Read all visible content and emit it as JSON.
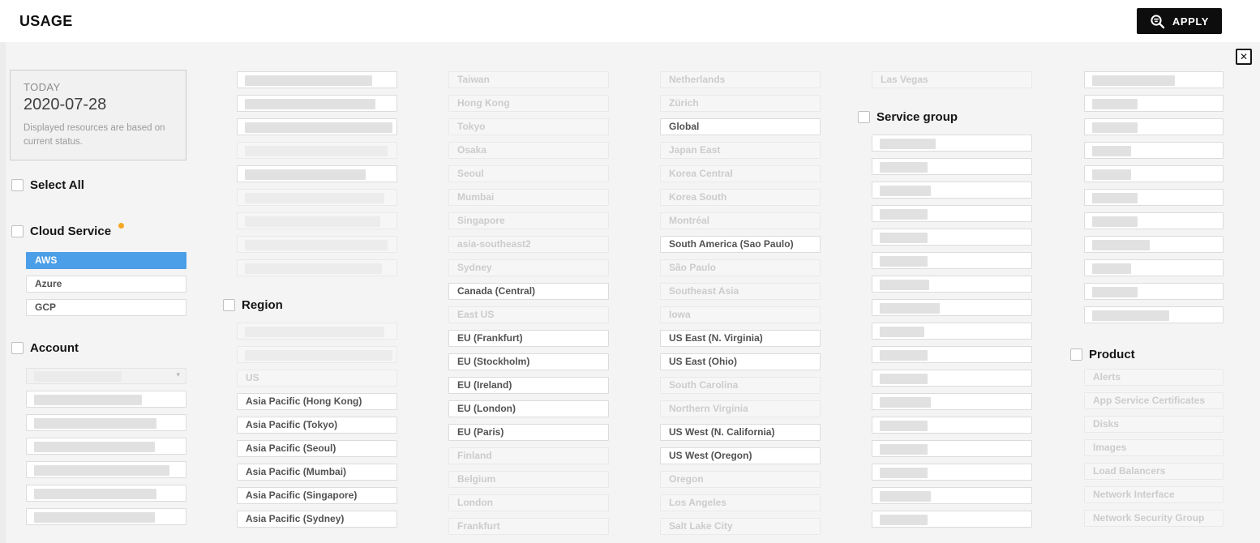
{
  "header": {
    "title": "USAGE",
    "apply_label": "APPLY",
    "apply_icon": "filter-search"
  },
  "colors": {
    "selected_blue": "#4B9EE8",
    "badge_orange": "#F5A623",
    "apply_black": "#0D0D0D"
  },
  "panel": {
    "close_glyph": "✕",
    "today": {
      "label": "TODAY",
      "date": "2020-07-28",
      "note": "Displayed resources are based on current status."
    },
    "select_all_label": "Select All",
    "cloud_service": {
      "label": "Cloud Service",
      "badge_color": "#F5A623",
      "items": [
        {
          "label": "AWS",
          "state": "selected"
        },
        {
          "label": "Azure",
          "state": "active"
        },
        {
          "label": "GCP",
          "state": "active"
        }
      ]
    },
    "account": {
      "label": "Account",
      "dropdown": {
        "redacted": true,
        "redact_w": 55
      },
      "items": [
        {
          "redacted": true,
          "state": "active",
          "redact_w": 68
        },
        {
          "redacted": true,
          "state": "active",
          "redact_w": 77
        },
        {
          "redacted": true,
          "state": "active",
          "redact_w": 76
        },
        {
          "redacted": true,
          "state": "active",
          "redact_w": 85
        },
        {
          "redacted": true,
          "state": "active",
          "redact_w": 77
        },
        {
          "redacted": true,
          "state": "active",
          "redact_w": 76
        }
      ]
    },
    "col2_top_items": [
      {
        "redacted": true,
        "state": "active",
        "redact_w": 80
      },
      {
        "redacted": true,
        "state": "active",
        "redact_w": 82
      },
      {
        "redacted": true,
        "state": "active",
        "redact_w": 93
      },
      {
        "redacted": true,
        "state": "disabled",
        "redact_w": 90
      },
      {
        "redacted": true,
        "state": "active",
        "redact_w": 76
      },
      {
        "redacted": true,
        "state": "disabled",
        "redact_w": 88
      },
      {
        "redacted": true,
        "state": "disabled",
        "redact_w": 85
      },
      {
        "redacted": true,
        "state": "disabled",
        "redact_w": 90
      },
      {
        "redacted": true,
        "state": "disabled",
        "redact_w": 86
      }
    ],
    "region": {
      "label": "Region",
      "col2_items": [
        {
          "redacted": true,
          "state": "disabled",
          "redact_w": 88
        },
        {
          "redacted": true,
          "state": "disabled",
          "redact_w": 93
        },
        {
          "label": "US",
          "state": "disabled"
        },
        {
          "label": "Asia Pacific (Hong Kong)",
          "state": "active"
        },
        {
          "label": "Asia Pacific (Tokyo)",
          "state": "active"
        },
        {
          "label": "Asia Pacific (Seoul)",
          "state": "active"
        },
        {
          "label": "Asia Pacific (Mumbai)",
          "state": "active"
        },
        {
          "label": "Asia Pacific (Singapore)",
          "state": "active"
        },
        {
          "label": "Asia Pacific (Sydney)",
          "state": "active"
        }
      ],
      "col3_items": [
        {
          "label": "Taiwan",
          "state": "disabled"
        },
        {
          "label": "Hong Kong",
          "state": "disabled"
        },
        {
          "label": "Tokyo",
          "state": "disabled"
        },
        {
          "label": "Osaka",
          "state": "disabled"
        },
        {
          "label": "Seoul",
          "state": "disabled"
        },
        {
          "label": "Mumbai",
          "state": "disabled"
        },
        {
          "label": "Singapore",
          "state": "disabled"
        },
        {
          "label": "asia-southeast2",
          "state": "disabled"
        },
        {
          "label": "Sydney",
          "state": "disabled"
        },
        {
          "label": "Canada (Central)",
          "state": "active"
        },
        {
          "label": "East US",
          "state": "disabled"
        },
        {
          "label": "EU (Frankfurt)",
          "state": "active"
        },
        {
          "label": "EU (Stockholm)",
          "state": "active"
        },
        {
          "label": "EU (Ireland)",
          "state": "active"
        },
        {
          "label": "EU (London)",
          "state": "active"
        },
        {
          "label": "EU (Paris)",
          "state": "active"
        },
        {
          "label": "Finland",
          "state": "disabled"
        },
        {
          "label": "Belgium",
          "state": "disabled"
        },
        {
          "label": "London",
          "state": "disabled"
        },
        {
          "label": "Frankfurt",
          "state": "disabled"
        }
      ],
      "col4_items": [
        {
          "label": "Netherlands",
          "state": "disabled"
        },
        {
          "label": "Zürich",
          "state": "disabled"
        },
        {
          "label": "Global",
          "state": "active"
        },
        {
          "label": "Japan East",
          "state": "disabled"
        },
        {
          "label": "Korea Central",
          "state": "disabled"
        },
        {
          "label": "Korea South",
          "state": "disabled"
        },
        {
          "label": "Montréal",
          "state": "disabled"
        },
        {
          "label": "South America (Sao Paulo)",
          "state": "active"
        },
        {
          "label": "São Paulo",
          "state": "disabled"
        },
        {
          "label": "Southeast Asia",
          "state": "disabled"
        },
        {
          "label": "Iowa",
          "state": "disabled"
        },
        {
          "label": "US East (N. Virginia)",
          "state": "active"
        },
        {
          "label": "US East (Ohio)",
          "state": "active"
        },
        {
          "label": "South Carolina",
          "state": "disabled"
        },
        {
          "label": "Northern Virginia",
          "state": "disabled"
        },
        {
          "label": "US West (N. California)",
          "state": "active"
        },
        {
          "label": "US West (Oregon)",
          "state": "active"
        },
        {
          "label": "Oregon",
          "state": "disabled"
        },
        {
          "label": "Los Angeles",
          "state": "disabled"
        },
        {
          "label": "Salt Lake City",
          "state": "disabled"
        }
      ],
      "col5_items": [
        {
          "label": "Las Vegas",
          "state": "disabled"
        }
      ]
    },
    "service_group": {
      "label": "Service group",
      "items": [
        {
          "redacted": true,
          "state": "active",
          "redact_w": 35
        },
        {
          "redacted": true,
          "state": "active",
          "redact_w": 30
        },
        {
          "redacted": true,
          "state": "active",
          "redact_w": 32
        },
        {
          "redacted": true,
          "state": "active",
          "redact_w": 30
        },
        {
          "redacted": true,
          "state": "active",
          "redact_w": 30
        },
        {
          "redacted": true,
          "state": "active",
          "redact_w": 30
        },
        {
          "redacted": true,
          "state": "active",
          "redact_w": 31
        },
        {
          "redacted": true,
          "state": "active",
          "redact_w": 38
        },
        {
          "redacted": true,
          "state": "active",
          "redact_w": 28
        },
        {
          "redacted": true,
          "state": "active",
          "redact_w": 30
        },
        {
          "redacted": true,
          "state": "active",
          "redact_w": 30
        },
        {
          "redacted": true,
          "state": "active",
          "redact_w": 32
        },
        {
          "redacted": true,
          "state": "active",
          "redact_w": 30
        },
        {
          "redacted": true,
          "state": "active",
          "redact_w": 30
        },
        {
          "redacted": true,
          "state": "active",
          "redact_w": 30
        },
        {
          "redacted": true,
          "state": "active",
          "redact_w": 32
        },
        {
          "redacted": true,
          "state": "active",
          "redact_w": 30
        }
      ]
    },
    "col6_top_items": [
      {
        "redacted": true,
        "state": "active",
        "redact_w": 60
      },
      {
        "redacted": true,
        "state": "active",
        "redact_w": 33
      },
      {
        "redacted": true,
        "state": "active",
        "redact_w": 33
      },
      {
        "redacted": true,
        "state": "active",
        "redact_w": 28
      },
      {
        "redacted": true,
        "state": "active",
        "redact_w": 28
      },
      {
        "redacted": true,
        "state": "active",
        "redact_w": 33
      },
      {
        "redacted": true,
        "state": "active",
        "redact_w": 33
      },
      {
        "redacted": true,
        "state": "active",
        "redact_w": 42
      },
      {
        "redacted": true,
        "state": "active",
        "redact_w": 28
      },
      {
        "redacted": true,
        "state": "active",
        "redact_w": 33
      },
      {
        "redacted": true,
        "state": "active",
        "redact_w": 56
      }
    ],
    "product": {
      "label": "Product",
      "items": [
        {
          "label": "Alerts",
          "state": "disabled"
        },
        {
          "label": "App Service Certificates",
          "state": "disabled"
        },
        {
          "label": "Disks",
          "state": "disabled"
        },
        {
          "label": "Images",
          "state": "disabled"
        },
        {
          "label": "Load Balancers",
          "state": "disabled"
        },
        {
          "label": "Network Interface",
          "state": "disabled"
        },
        {
          "label": "Network Security Group",
          "state": "disabled"
        }
      ]
    }
  }
}
